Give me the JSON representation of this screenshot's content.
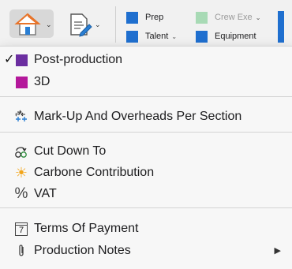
{
  "toolbar": {
    "legend": [
      {
        "label": "Prep",
        "color": "#1f6fcf",
        "dropdown": false
      },
      {
        "label": "Crew Exe",
        "color": "#a8dab5",
        "dropdown": true
      },
      {
        "label": "Talent",
        "color": "#1f6fcf",
        "dropdown": true
      },
      {
        "label": "Equipment",
        "color": "#1f6fcf",
        "dropdown": false
      }
    ],
    "chevron": "⌄"
  },
  "menu": {
    "checkmark": "✓",
    "submenu_arrow": "▶",
    "items": [
      {
        "label": "Post-production",
        "icon": "purple-swatch",
        "color": "#6b2ea0",
        "checked": true
      },
      {
        "label": "3D",
        "icon": "magenta-swatch",
        "color": "#b4189b",
        "checked": false
      },
      {
        "label": "Mark-Up And Overheads Per Section",
        "icon": "markup-icon",
        "glyph": "⇄"
      },
      {
        "label": "Cut Down To",
        "icon": "cut-down-icon"
      },
      {
        "label": "Carbone Contribution",
        "icon": "sun-icon",
        "glyph": "☀",
        "color": "#f2a51a"
      },
      {
        "label": "VAT",
        "icon": "percent-icon",
        "glyph": "%"
      },
      {
        "label": "Terms Of Payment",
        "icon": "calendar-icon",
        "glyph": "7"
      },
      {
        "label": "Production Notes",
        "icon": "paperclip-icon",
        "has_submenu": true
      }
    ]
  }
}
